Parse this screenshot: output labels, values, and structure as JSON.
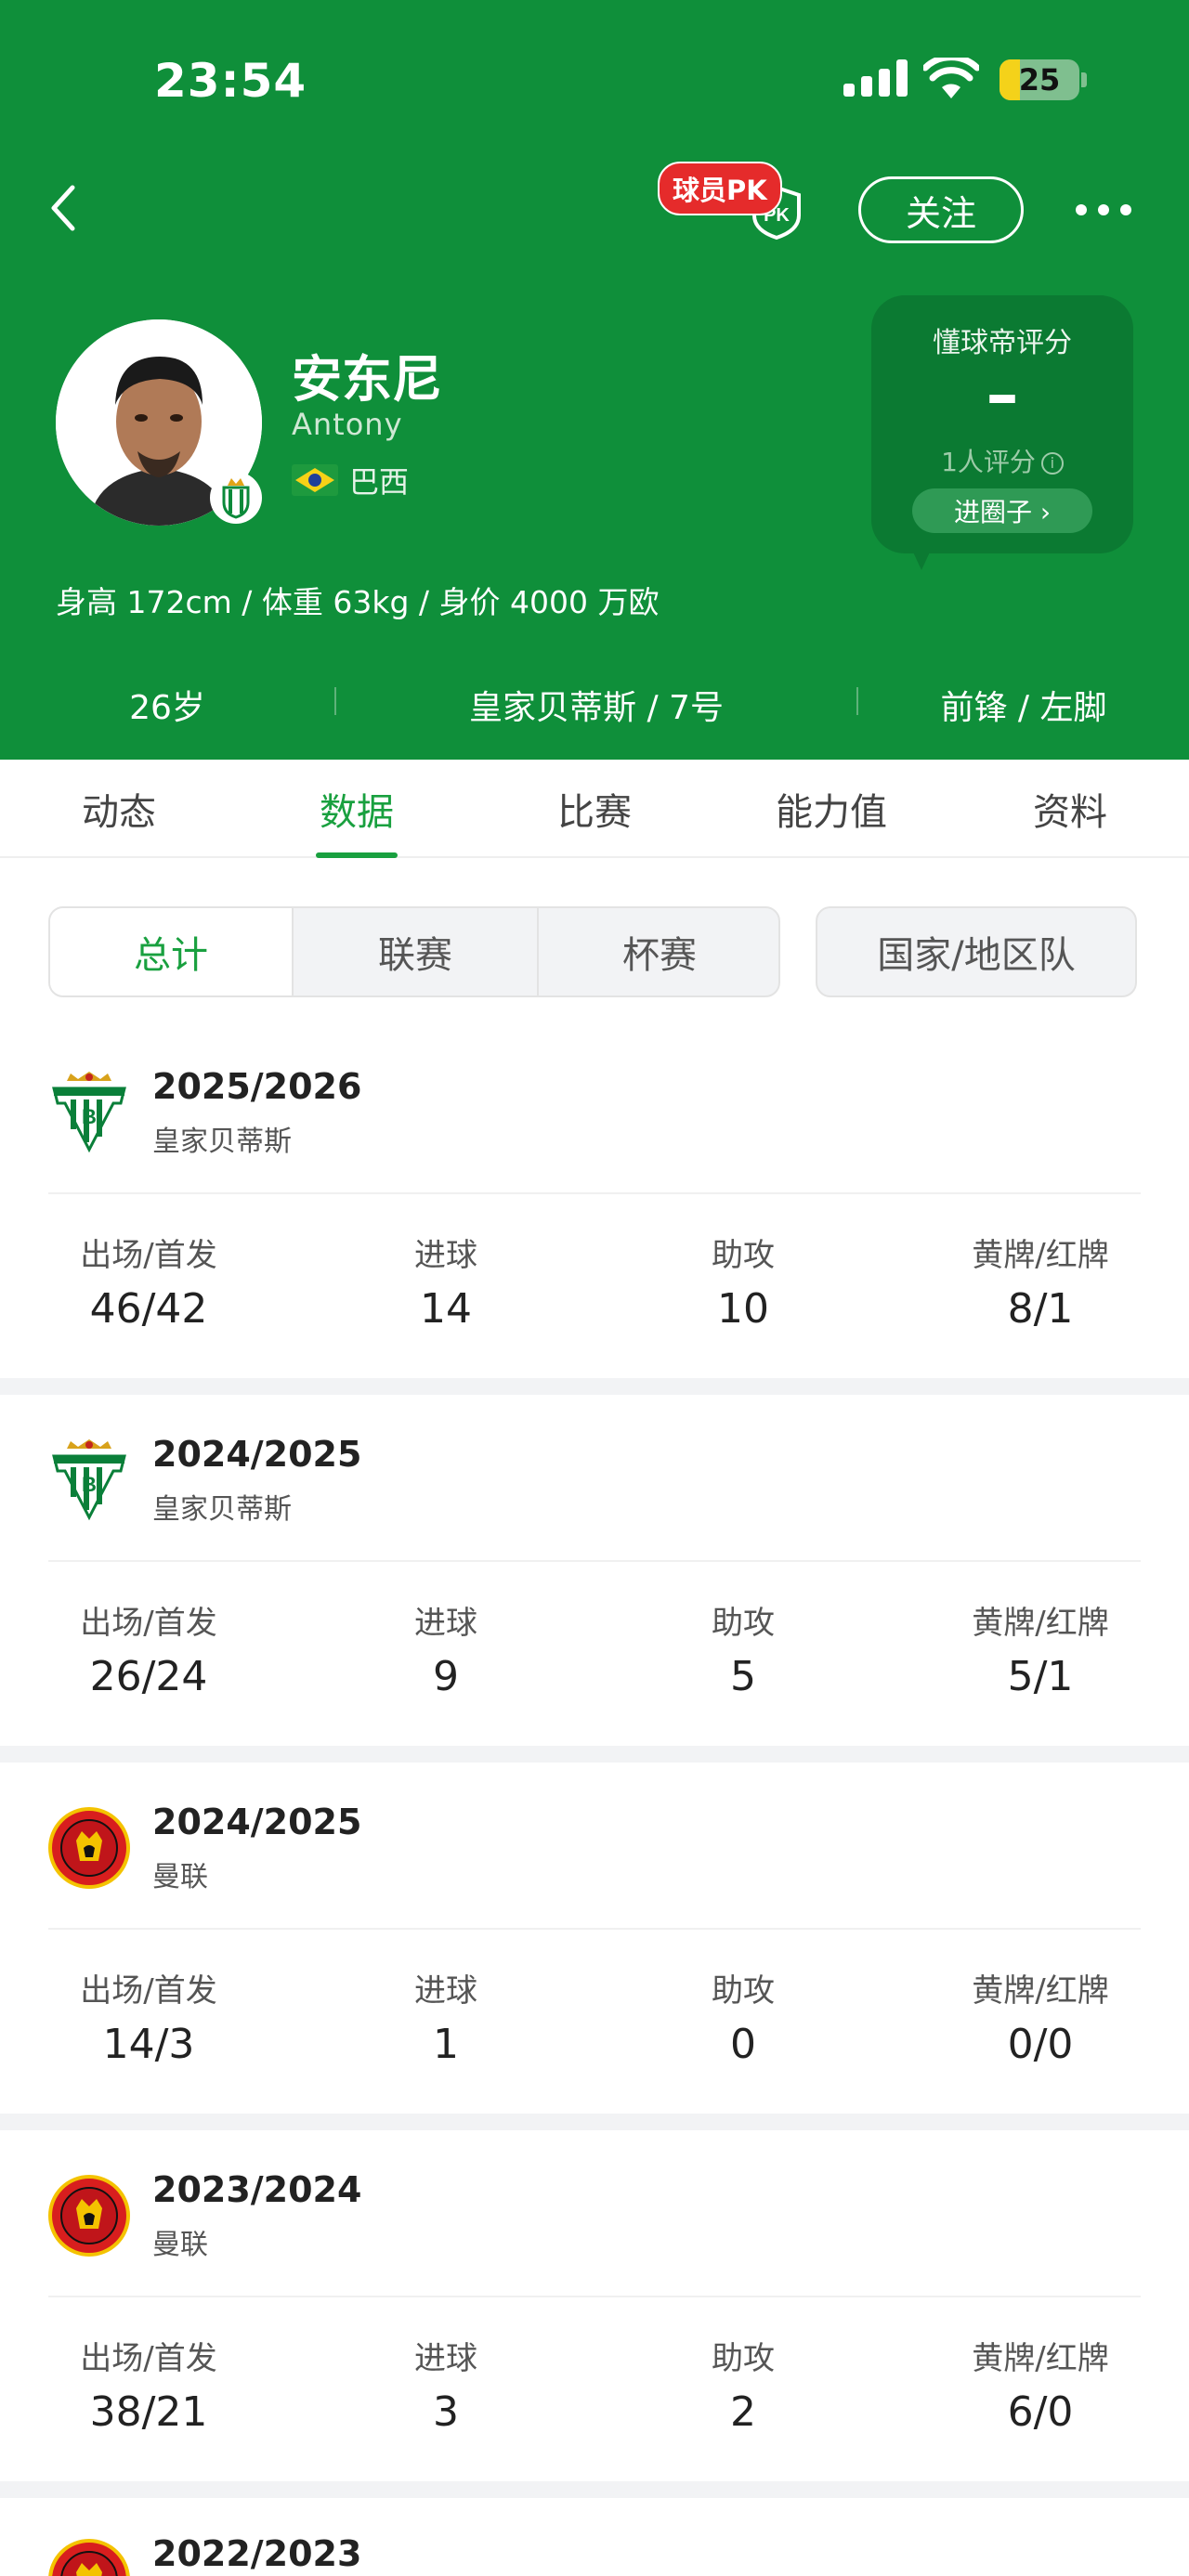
{
  "status_bar": {
    "time": "23:54",
    "battery": "25",
    "battery_level": 0.25
  },
  "header": {
    "pk_label": "球员PK",
    "follow_label": "关注",
    "player": {
      "name_cn": "安东尼",
      "name_en": "Antony",
      "nation": "巴西",
      "body_info": "身高 172cm / 体重 63kg / 身价 4000 万欧",
      "age": "26岁",
      "team_number": "皇家贝蒂斯 / 7号",
      "position_foot": "前锋 / 左脚"
    },
    "rating": {
      "title": "懂球帝评分",
      "value": "–",
      "count": "1人评分",
      "info_icon": "i",
      "enter_label": "进圈子 ›"
    }
  },
  "tabs": [
    {
      "label": "动态",
      "active": false
    },
    {
      "label": "数据",
      "active": true
    },
    {
      "label": "比赛",
      "active": false
    },
    {
      "label": "能力值",
      "active": false
    },
    {
      "label": "资料",
      "active": false
    }
  ],
  "filters": {
    "segments": [
      {
        "label": "总计",
        "active": true
      },
      {
        "label": "联赛",
        "active": false
      },
      {
        "label": "杯赛",
        "active": false
      }
    ],
    "nation_team": "国家/地区队"
  },
  "stat_labels": [
    "出场/首发",
    "进球",
    "助攻",
    "黄牌/红牌"
  ],
  "seasons": [
    {
      "year": "2025/2026",
      "club": "皇家贝蒂斯",
      "logo": "betis-icon",
      "stats": [
        "46/42",
        "14",
        "10",
        "8/1"
      ]
    },
    {
      "year": "2024/2025",
      "club": "皇家贝蒂斯",
      "logo": "betis-icon",
      "stats": [
        "26/24",
        "9",
        "5",
        "5/1"
      ]
    },
    {
      "year": "2024/2025",
      "club": "曼联",
      "logo": "man-united-icon",
      "stats": [
        "14/3",
        "1",
        "0",
        "0/0"
      ]
    },
    {
      "year": "2023/2024",
      "club": "曼联",
      "logo": "man-united-icon",
      "stats": [
        "38/21",
        "3",
        "2",
        "6/0"
      ]
    }
  ],
  "partial_season": {
    "year": "2022/2023",
    "logo": "man-united-icon"
  },
  "colors": {
    "header_green": "#0f8f3a",
    "accent_green": "#19a03f",
    "pk_red": "#e52b2b"
  }
}
